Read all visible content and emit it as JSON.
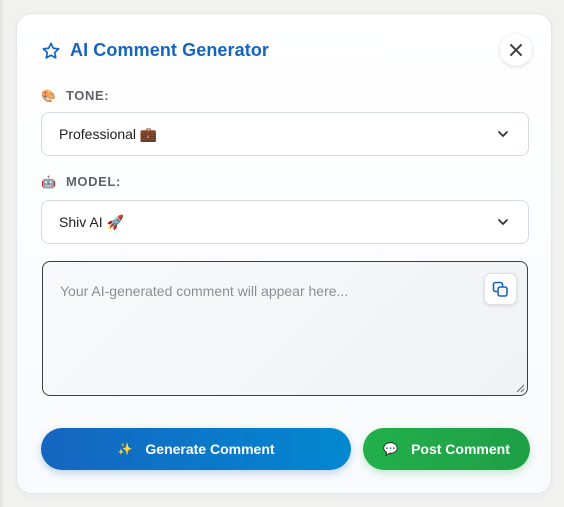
{
  "header": {
    "title": "AI Comment Generator",
    "icon": "star-outline-icon"
  },
  "close": {
    "icon": "close-icon",
    "glyph": "✕"
  },
  "tone": {
    "label": "TONE:",
    "emoji": "🎨",
    "selected": "Professional 💼"
  },
  "model": {
    "label": "MODEL:",
    "emoji": "🤖",
    "selected": "Shiv AI 🚀"
  },
  "output": {
    "placeholder": "Your AI-generated comment will appear here...",
    "copy_icon": "copy-icon"
  },
  "actions": {
    "generate_emoji": "✨",
    "generate_label": "Generate Comment",
    "post_emoji": "💬",
    "post_label": "Post Comment"
  },
  "colors": {
    "title": "#1565c0",
    "generate_start": "#1565c0",
    "generate_end": "#0288d1",
    "post": "#22b04b"
  }
}
